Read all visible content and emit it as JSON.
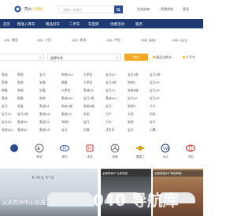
{
  "header": {
    "city": "苏州",
    "city_switch": "[切换]",
    "search_placeholder": "请输入关键词",
    "links": [
      "在线咨询",
      "免费热线",
      "登录"
    ]
  },
  "nav": {
    "items": [
      "首页",
      "精准入库车",
      "精品好车",
      "二手车",
      "车型库",
      "优惠活动",
      "服务"
    ]
  },
  "filter": {
    "types": [
      "微型",
      "小型",
      "紧凑",
      "中型",
      "MPV",
      "SUV"
    ],
    "selects": [
      "",
      "选择车系"
    ],
    "button": "找车",
    "extras": [
      "精品全新车",
      "二手车"
    ]
  },
  "grid": {
    "rows": [
      [
        "1",
        "奥迪",
        "奔驰",
        "宝马",
        "奔驰GLC",
        "卡罗拉",
        "宝马X3",
        "宝马3系",
        "宝马5系"
      ],
      [
        "2",
        "荣威",
        "奔驰",
        "轩逸",
        "朗逸",
        "卡罗拉",
        "宝马5系",
        "奔驰C",
        "宝马X5"
      ],
      [
        "3",
        "朗逸",
        "奔驰",
        "轩逸",
        "卡罗拉",
        "奥迪Q5",
        "宝马X1",
        "奔驰E级",
        "宝马X5"
      ],
      [
        "4",
        "奥迪",
        "朗逸",
        "奔驰",
        "奥迪A6L",
        "宝马3系",
        "奥迪A4L",
        "宝马X5",
        "宝马X3"
      ],
      [
        "5",
        "宝马",
        "轩逸",
        "奥迪A4",
        "奔驰C级",
        "奔驰E级",
        "宝马",
        "奔驰S",
        "大众"
      ],
      [
        "6",
        "宝马X5",
        "宝马3系",
        "奥迪A4L",
        "奥迪Q5",
        "本田",
        "日产",
        "丰田",
        "别克"
      ],
      [
        "7",
        "宝马X1",
        "奥迪A6",
        "奥迪Q3",
        "奔驰C",
        "宝马",
        "大众",
        "奔驰",
        "宝马"
      ],
      [
        "8",
        "奔驰GLC",
        "奥迪A4",
        "奥迪Q5",
        "宝马",
        "红旗",
        "沃尔沃",
        "宝马",
        "小鹏"
      ]
    ]
  },
  "logos": {
    "items": [
      {
        "name": "",
        "icon": "brand-logo-icon"
      },
      {
        "name": "别克",
        "icon": "buick-logo-icon"
      },
      {
        "name": "现代",
        "icon": "hyundai-logo-icon"
      },
      {
        "name": "本田",
        "icon": "honda-logo-icon"
      },
      {
        "name": "奔驰",
        "icon": "mercedes-logo-icon"
      },
      {
        "name": "雪佛兰",
        "icon": "chevrolet-logo-icon"
      },
      {
        "name": "大众",
        "icon": "volkswagen-logo-icon"
      },
      {
        "name": "丰田",
        "icon": "toyota-logo-icon"
      }
    ]
  },
  "banner": {
    "brand": "VOLVO",
    "title": "沃沃苏州中心巡展",
    "promos": [
      "全新林肯Z 为你而来",
      "全新奥迪A8 驾控新境"
    ]
  },
  "watermark": "040 导航库",
  "colors": {
    "nav_bg": "#1f3a73",
    "accent": "#f5a623",
    "search_btn": "#2b4c8f"
  }
}
